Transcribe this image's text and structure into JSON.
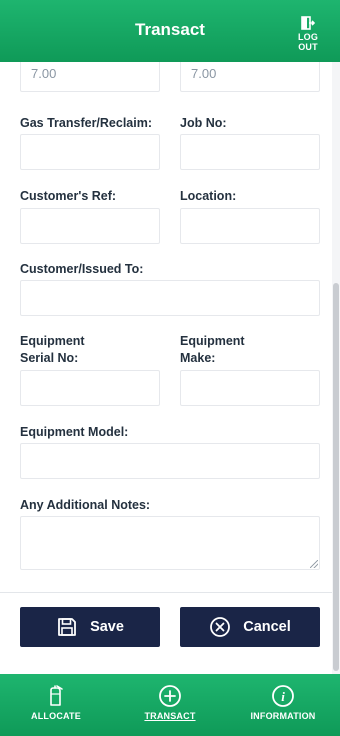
{
  "header": {
    "title": "Transact",
    "logout_label": "LOG OUT"
  },
  "form": {
    "quantity_left": "7.00",
    "quantity_right": "7.00",
    "gas_transfer_label": "Gas Transfer/Reclaim:",
    "job_no_label": "Job No:",
    "customers_ref_label": "Customer's Ref:",
    "location_label": "Location:",
    "customer_issued_label": "Customer/Issued To:",
    "equipment_serial_label_line1": "Equipment",
    "equipment_serial_label_line2": "Serial No:",
    "equipment_make_label_line1": "Equipment",
    "equipment_make_label_line2": "Make:",
    "equipment_model_label": "Equipment Model:",
    "additional_notes_label": "Any Additional Notes:"
  },
  "actions": {
    "save_label": "Save",
    "cancel_label": "Cancel"
  },
  "bottom_nav": {
    "items": [
      {
        "label": "ALLOCATE",
        "icon": "cylinder-icon"
      },
      {
        "label": "TRANSACT",
        "icon": "plus-circle-icon",
        "active": true
      },
      {
        "label": "INFORMATION",
        "icon": "info-circle-icon"
      }
    ]
  },
  "colors": {
    "brand_green": "#14a862",
    "button_navy": "#1a2547"
  }
}
